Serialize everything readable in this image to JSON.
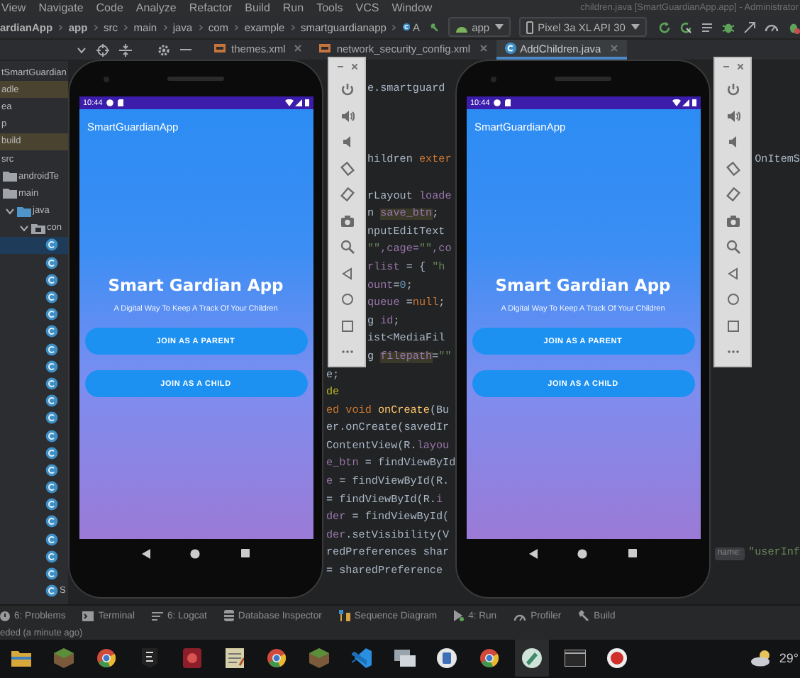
{
  "menu_bar": {
    "items": [
      "View",
      "Navigate",
      "Code",
      "Analyze",
      "Refactor",
      "Build",
      "Run",
      "Tools",
      "VCS",
      "Window"
    ],
    "window_title": "children.java [SmartGuardianApp.app] - Administrator"
  },
  "navigation_bar": {
    "breadcrumbs": [
      {
        "label": "ardianApp",
        "kind": "project"
      },
      {
        "label": "app",
        "kind": "module"
      },
      {
        "label": "src",
        "kind": "folder"
      },
      {
        "label": "main",
        "kind": "folder"
      },
      {
        "label": "java",
        "kind": "folder"
      },
      {
        "label": "com",
        "kind": "folder"
      },
      {
        "label": "example",
        "kind": "folder"
      },
      {
        "label": "smartguardianapp",
        "kind": "folder"
      }
    ],
    "class_label": "A",
    "run_config": "app",
    "device": "Pixel 3a XL API 30"
  },
  "editor_tabs": [
    {
      "label": "themes.xml",
      "kind": "xml",
      "selected": false
    },
    {
      "label": "network_security_config.xml",
      "kind": "xml",
      "selected": false
    },
    {
      "label": "AddChildren.java",
      "kind": "java",
      "selected": true
    }
  ],
  "project_tree": [
    {
      "label": "tSmartGuardian",
      "kind": "text",
      "selected": false,
      "highlighted": false
    },
    {
      "label": "adle",
      "kind": "text",
      "selected": false,
      "highlighted": true
    },
    {
      "label": "ea",
      "kind": "text",
      "selected": false,
      "highlighted": false
    },
    {
      "label": "p",
      "kind": "text",
      "selected": false,
      "highlighted": false
    },
    {
      "label": "build",
      "kind": "text",
      "selected": false,
      "highlighted": true
    },
    {
      "label": "src",
      "kind": "text",
      "selected": false,
      "highlighted": false,
      "children": [
        {
          "label": "androidTe",
          "kind": "folder",
          "selected": false,
          "highlighted": false
        },
        {
          "label": "main",
          "kind": "folder",
          "selected": false,
          "highlighted": false,
          "children": [
            {
              "label": "java",
              "kind": "source-folder",
              "expanded": true,
              "selected": false,
              "highlighted": false,
              "children": [
                {
                  "label": "con",
                  "kind": "package",
                  "expanded": true,
                  "selected": false,
                  "highlighted": false,
                  "children": [
                    {
                      "kind": "class",
                      "selected": true,
                      "highlighted": false
                    },
                    {
                      "kind": "class",
                      "selected": false,
                      "highlighted": false
                    },
                    {
                      "kind": "class",
                      "selected": false,
                      "highlighted": false
                    },
                    {
                      "kind": "class",
                      "selected": false,
                      "highlighted": false
                    },
                    {
                      "kind": "class",
                      "selected": false,
                      "highlighted": false
                    },
                    {
                      "kind": "class",
                      "selected": false,
                      "highlighted": false
                    },
                    {
                      "kind": "class",
                      "selected": false,
                      "highlighted": false
                    },
                    {
                      "kind": "class",
                      "selected": false,
                      "highlighted": false
                    },
                    {
                      "kind": "class",
                      "selected": false,
                      "highlighted": false
                    },
                    {
                      "kind": "class",
                      "selected": false,
                      "highlighted": false
                    },
                    {
                      "kind": "class",
                      "selected": false,
                      "highlighted": false
                    },
                    {
                      "kind": "class",
                      "selected": false,
                      "highlighted": false
                    },
                    {
                      "kind": "class",
                      "selected": false,
                      "highlighted": false
                    },
                    {
                      "kind": "class",
                      "selected": false,
                      "highlighted": false
                    },
                    {
                      "kind": "class",
                      "selected": false,
                      "highlighted": false
                    },
                    {
                      "kind": "class",
                      "selected": false,
                      "highlighted": false
                    },
                    {
                      "kind": "class",
                      "selected": false,
                      "highlighted": false
                    },
                    {
                      "kind": "class",
                      "selected": false,
                      "highlighted": false
                    },
                    {
                      "kind": "class",
                      "selected": false,
                      "highlighted": false
                    },
                    {
                      "kind": "class",
                      "selected": false,
                      "highlighted": false
                    },
                    {
                      "label": "S",
                      "kind": "class",
                      "selected": false,
                      "highlighted": false
                    }
                  ]
                }
              ]
            }
          ]
        }
      ]
    }
  ],
  "code_editor": {
    "lines_beside_toolbar": [
      {
        "kind": "code",
        "segments": [
          {
            "text": "e.smartguard",
            "kind": "plain"
          }
        ]
      },
      {
        "kind": "blank"
      },
      {
        "kind": "blank"
      },
      {
        "kind": "blank"
      },
      {
        "kind": "code",
        "segments": [
          {
            "text": "hildren ",
            "kind": "plain"
          },
          {
            "text": "exter",
            "kind": "keyword"
          }
        ],
        "right": {
          "segments": [
            {
              "text": "OnItemS",
              "kind": "plain"
            }
          ]
        }
      },
      {
        "kind": "blank"
      },
      {
        "kind": "code",
        "segments": [
          {
            "text": "rLayout ",
            "kind": "plain"
          },
          {
            "text": "loade",
            "kind": "field"
          }
        ]
      },
      {
        "kind": "code",
        "segments": [
          {
            "text": "n ",
            "kind": "plain"
          },
          {
            "text": "save_btn",
            "kind": "highlight"
          },
          {
            "text": ";",
            "kind": "plain"
          }
        ]
      },
      {
        "kind": "code",
        "segments": [
          {
            "text": "nputEditText",
            "kind": "plain"
          }
        ]
      },
      {
        "kind": "code",
        "segments": [
          {
            "text": "\"\"",
            "kind": "string"
          },
          {
            "text": ",cage=",
            "kind": "field"
          },
          {
            "text": "\"\"",
            "kind": "string"
          },
          {
            "text": ",co",
            "kind": "field"
          }
        ]
      },
      {
        "kind": "code",
        "segments": [
          {
            "text": "rlist",
            "kind": "field"
          },
          {
            "text": " = { ",
            "kind": "plain"
          },
          {
            "text": "\"h",
            "kind": "string"
          }
        ]
      },
      {
        "kind": "code",
        "segments": [
          {
            "text": "ount",
            "kind": "field"
          },
          {
            "text": "=",
            "kind": "plain"
          },
          {
            "text": "0",
            "kind": "number"
          },
          {
            "text": ";",
            "kind": "plain"
          }
        ]
      },
      {
        "kind": "code",
        "segments": [
          {
            "text": "queue",
            "kind": "field"
          },
          {
            "text": " =",
            "kind": "plain"
          },
          {
            "text": "null",
            "kind": "keyword"
          },
          {
            "text": ";",
            "kind": "plain"
          }
        ]
      },
      {
        "kind": "code",
        "segments": [
          {
            "text": "g ",
            "kind": "plain"
          },
          {
            "text": "id",
            "kind": "field"
          },
          {
            "text": ";",
            "kind": "plain"
          }
        ]
      },
      {
        "kind": "code",
        "segments": [
          {
            "text": "ist<MediaFil",
            "kind": "plain"
          }
        ]
      },
      {
        "kind": "code",
        "segments": [
          {
            "text": "g ",
            "kind": "plain"
          },
          {
            "text": "filepath",
            "kind": "highlight"
          },
          {
            "text": "=",
            "kind": "plain"
          },
          {
            "text": "\"\"",
            "kind": "string"
          }
        ]
      }
    ],
    "lines_below_toolbar": [
      {
        "kind": "code",
        "segments": [
          {
            "text": "e;",
            "kind": "plain"
          }
        ]
      },
      {
        "kind": "code",
        "segments": [
          {
            "text": "de",
            "kind": "annotation"
          }
        ]
      },
      {
        "kind": "code",
        "segments": [
          {
            "text": "ed void ",
            "kind": "keyword"
          },
          {
            "text": "onCreate",
            "kind": "method"
          },
          {
            "text": "(Bu",
            "kind": "plain"
          }
        ]
      },
      {
        "kind": "code",
        "segments": [
          {
            "text": "er.",
            "kind": "plain"
          },
          {
            "text": "onCreate",
            "kind": "plain"
          },
          {
            "text": "(savedIr",
            "kind": "plain"
          }
        ]
      },
      {
        "kind": "code",
        "segments": [
          {
            "text": "ContentView(R.",
            "kind": "plain"
          },
          {
            "text": "layou",
            "kind": "field"
          }
        ]
      },
      {
        "kind": "code",
        "segments": [
          {
            "text": "e_btn",
            "kind": "field"
          },
          {
            "text": " = findViewById",
            "kind": "plain"
          }
        ]
      },
      {
        "kind": "code",
        "segments": [
          {
            "text": "e",
            "kind": "field"
          },
          {
            "text": " = findViewById(R.",
            "kind": "plain"
          }
        ]
      },
      {
        "kind": "code",
        "segments": [
          {
            "text": "= findViewById(R.",
            "kind": "plain"
          },
          {
            "text": "i",
            "kind": "field"
          }
        ]
      },
      {
        "kind": "code",
        "segments": [
          {
            "text": "der",
            "kind": "field"
          },
          {
            "text": " = findViewById(",
            "kind": "plain"
          }
        ]
      },
      {
        "kind": "code",
        "segments": [
          {
            "text": "der",
            "kind": "field"
          },
          {
            "text": ".setVisibility(V",
            "kind": "plain"
          }
        ]
      },
      {
        "kind": "code",
        "segments": [
          {
            "text": "redPreferences shar",
            "kind": "plain"
          }
        ],
        "right": {
          "hint": "name:",
          "segments": [
            {
              "text": "\"userInf",
              "kind": "string"
            }
          ]
        }
      },
      {
        "kind": "code",
        "segments": [
          {
            "text": "=  sharedPreference",
            "kind": "plain"
          }
        ]
      }
    ]
  },
  "emulators": [
    {
      "time": "10:44",
      "app_title": "SmartGuardianApp",
      "headline": "Smart Gardian App",
      "tagline": "A Digital Way To Keep A Track Of Your Children",
      "buttons": [
        "JOIN AS A PARENT",
        "JOIN AS A CHILD"
      ]
    },
    {
      "time": "10:44",
      "app_title": "SmartGuardianApp",
      "headline": "Smart Gardian App",
      "tagline": "A Digital Way To Keep A Track Of Your Children",
      "buttons": [
        "JOIN AS A PARENT",
        "JOIN AS A CHILD"
      ]
    }
  ],
  "tool_windows": [
    {
      "label": "6: Problems",
      "kind": "problems"
    },
    {
      "label": "Terminal",
      "kind": "terminal"
    },
    {
      "label": "6: Logcat",
      "kind": "logcat"
    },
    {
      "label": "Database Inspector",
      "kind": "database"
    },
    {
      "label": "Sequence Diagram",
      "kind": "sequence"
    },
    {
      "label": "4: Run",
      "kind": "run"
    },
    {
      "label": "Profiler",
      "kind": "profiler"
    },
    {
      "label": "Build",
      "kind": "build"
    }
  ],
  "status_text": "eded (a minute ago)",
  "taskbar": {
    "apps": [
      {
        "kind": "explorer",
        "active": false
      },
      {
        "kind": "block",
        "active": false
      },
      {
        "kind": "chrome",
        "active": false
      },
      {
        "kind": "epic",
        "active": false
      },
      {
        "kind": "game",
        "active": false
      },
      {
        "kind": "notepad",
        "active": false
      },
      {
        "kind": "chrome",
        "active": false
      },
      {
        "kind": "block",
        "active": false
      },
      {
        "kind": "vscode",
        "active": false
      },
      {
        "kind": "remote",
        "active": false
      },
      {
        "kind": "app",
        "active": false
      },
      {
        "kind": "chrome",
        "active": false
      },
      {
        "kind": "studio",
        "active": true
      },
      {
        "kind": "terminal",
        "active": false
      },
      {
        "kind": "recorder",
        "active": false
      }
    ],
    "temperature": "29°"
  }
}
